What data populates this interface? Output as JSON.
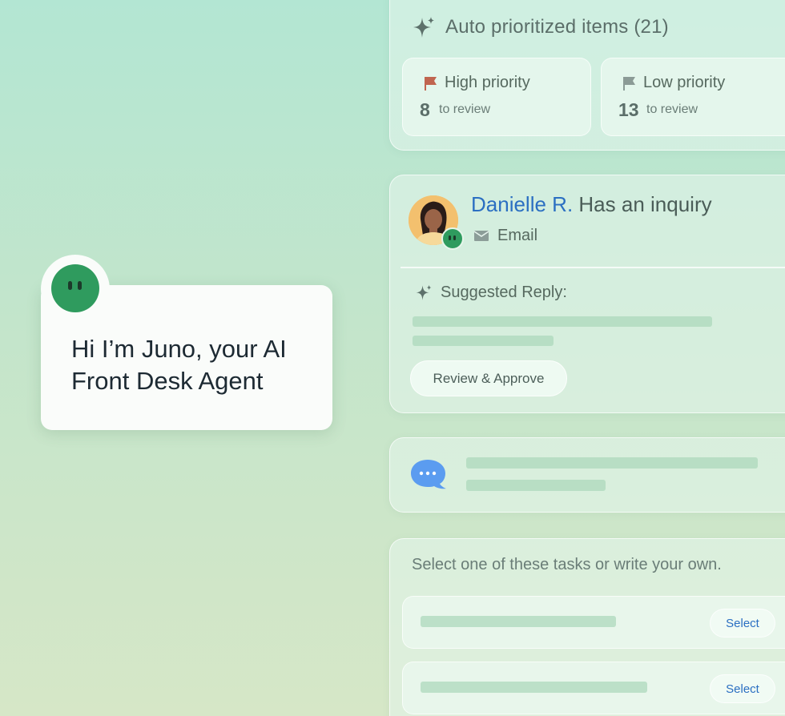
{
  "priority": {
    "title": "Auto prioritized items (21)",
    "high": {
      "label": "High priority",
      "count": "8",
      "sub": "to review",
      "flag_color": "#c0654f"
    },
    "low": {
      "label": "Low priority",
      "count": "13",
      "sub": "to review",
      "flag_color": "#8b9b96"
    }
  },
  "inquiry": {
    "name": "Danielle R.",
    "rest": "Has an inquiry",
    "channel": "Email",
    "suggested_label": "Suggested Reply:",
    "action_label": "Review & Approve"
  },
  "tasks": {
    "prompt": "Select one of these tasks or write your own.",
    "select_label_1": "Select",
    "select_label_2": "Select"
  },
  "juno": {
    "greeting": "Hi I’m Juno, your AI Front Desk Agent"
  },
  "colors": {
    "accent_blue": "#2b6fc2",
    "bot_green": "#2f9b5e",
    "chat_bubble": "#5b9cf0"
  }
}
